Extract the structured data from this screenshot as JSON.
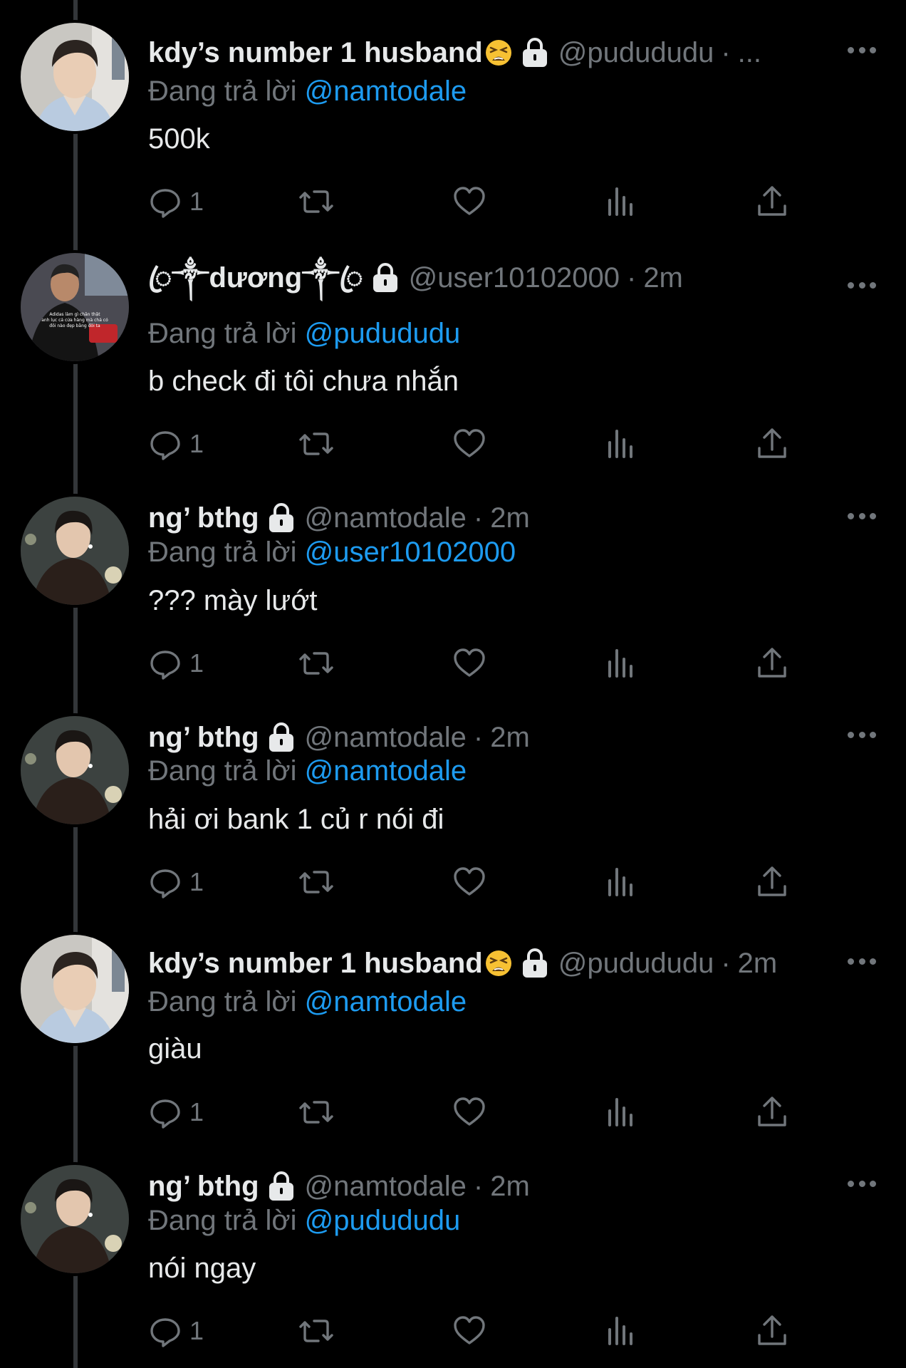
{
  "tweets": [
    {
      "display_name": "kdy’s number 1 husband",
      "handle": "@pudududu",
      "separator": "·",
      "time": "...",
      "reply_prefix": "Đang trả lời",
      "reply_to": "@namtodale",
      "text": "500k",
      "reply_count": "1",
      "emoji": "tired-face-emoji",
      "avatar": "man-light-shirt-avatar"
    },
    {
      "display_name": "ꦿ༒dương༒ꦿ",
      "handle": "@user10102000",
      "separator": "·",
      "time": "2m",
      "reply_prefix": "Đang trả lời",
      "reply_to": "@pudududu",
      "text": "b check đi tôi chưa nhắn",
      "reply_count": "1",
      "avatar": "man-black-shirt-caption-avatar",
      "avatar_caption": [
        "Adidas làm gì chăn thật",
        "anh lục cả cửa hàng mà chả có",
        "đôi nào đẹp bằng đôi ta"
      ]
    },
    {
      "display_name": "ng’ bthg",
      "handle": "@namtodale",
      "separator": "·",
      "time": "2m",
      "reply_prefix": "Đang trả lời",
      "reply_to": "@user10102000",
      "text": "??? mày lướt",
      "reply_count": "1",
      "avatar": "man-leather-jacket-avatar"
    },
    {
      "display_name": "ng’ bthg",
      "handle": "@namtodale",
      "separator": "·",
      "time": "2m",
      "reply_prefix": "Đang trả lời",
      "reply_to": "@namtodale",
      "text": "hải ơi bank 1 củ r nói đi",
      "reply_count": "1",
      "avatar": "man-leather-jacket-avatar"
    },
    {
      "display_name": "kdy’s number 1 husband",
      "handle": "@pudududu",
      "separator": "·",
      "time": "2m",
      "reply_prefix": "Đang trả lời",
      "reply_to": "@namtodale",
      "text": "giàu",
      "reply_count": "1",
      "emoji": "tired-face-emoji",
      "avatar": "man-light-shirt-avatar"
    },
    {
      "display_name": "ng’ bthg",
      "handle": "@namtodale",
      "separator": "·",
      "time": "2m",
      "reply_prefix": "Đang trả lời",
      "reply_to": "@pudududu",
      "text": "nói ngay",
      "reply_count": "1",
      "avatar": "man-leather-jacket-avatar"
    }
  ],
  "colors": {
    "background": "#000000",
    "text": "#e7e9ea",
    "secondary": "#71767b",
    "mention": "#1d9bf0",
    "thread_line": "#333639"
  },
  "icons": {
    "more": "more-horizontal-icon",
    "lock": "lock-icon",
    "reply": "reply-icon",
    "retweet": "retweet-icon",
    "like": "like-icon",
    "views": "views-icon",
    "share": "share-icon"
  }
}
